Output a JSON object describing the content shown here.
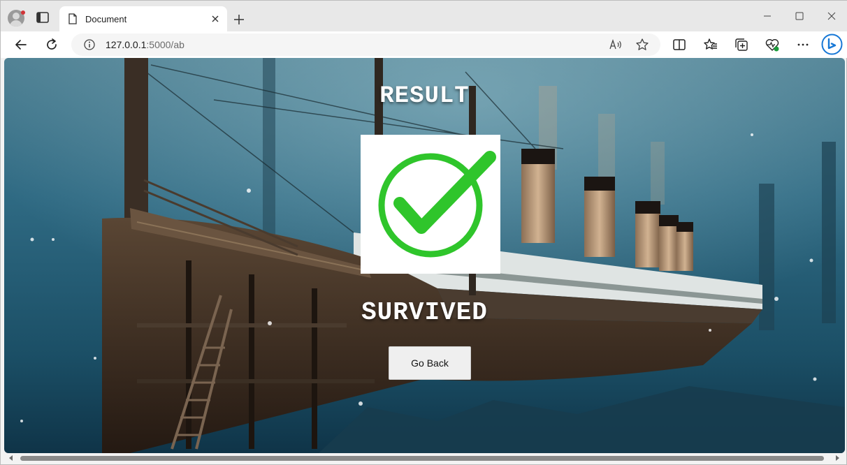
{
  "browser": {
    "tab_title": "Document",
    "url_host": "127.0.0.1",
    "url_rest": ":5000/ab",
    "icons": {
      "profile": "profile-icon",
      "tab_actions": "tab-actions-icon",
      "page": "document-icon",
      "close_tab": "close-icon",
      "new_tab": "plus-icon",
      "minimize": "minimize-icon",
      "maximize": "maximize-icon",
      "close_window": "close-icon",
      "back": "back-arrow-icon",
      "refresh": "refresh-icon",
      "info": "info-icon",
      "read_aloud": "read-aloud-icon",
      "favorite": "star-icon",
      "split_screen": "split-screen-icon",
      "favorites": "favorites-icon",
      "collections": "collections-icon",
      "browser_essentials": "heart-pulse-icon",
      "more": "more-icon",
      "copilot": "copilot-icon"
    }
  },
  "page": {
    "heading": "RESULT",
    "status": "SURVIVED",
    "button_label": "Go Back",
    "check_color": "#2fc52b"
  }
}
